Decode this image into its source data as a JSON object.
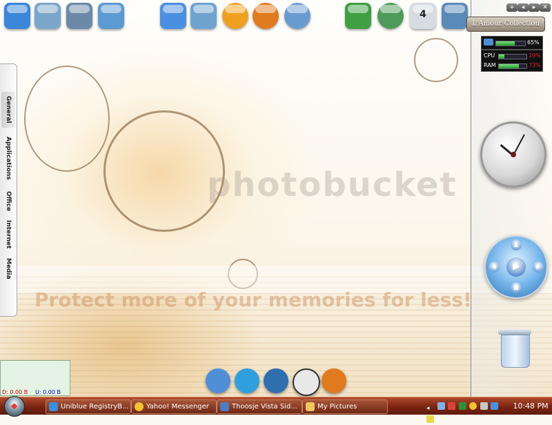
{
  "desktop": {
    "watermark_brand": "photobucket",
    "watermark_line": "Protect more of your memories for less!"
  },
  "top_icons": [
    {
      "name": "my-computer-icon",
      "color": "#3a86d8"
    },
    {
      "name": "documents-icon",
      "color": "#7aa7c9"
    },
    {
      "name": "media-icon",
      "color": "#6c8aa8"
    },
    {
      "name": "network-icon",
      "color": "#5c9ad2"
    },
    {
      "name": "explorer-icon",
      "color": "#4a8fe0"
    },
    {
      "name": "transfer-icon",
      "color": "#6fa3cf"
    },
    {
      "name": "messenger-icon",
      "color": "#f0a020"
    },
    {
      "name": "firefox-icon",
      "color": "#e07a1e"
    },
    {
      "name": "search-icon",
      "color": "#6a9bd0"
    },
    {
      "name": "gecko-icon",
      "color": "#3ea043"
    },
    {
      "name": "settings-icon",
      "color": "#4e9a5a"
    },
    {
      "name": "calendar-icon",
      "color": "#d7dbe2"
    },
    {
      "name": "ship-icon",
      "color": "#5a8ab8"
    }
  ],
  "calendar_day": "4",
  "sidetabs": [
    {
      "label": "General",
      "active": true
    },
    {
      "label": "Applications",
      "active": false
    },
    {
      "label": "Office",
      "active": false
    },
    {
      "label": "Internet",
      "active": false
    },
    {
      "label": "Media",
      "active": false
    }
  ],
  "sidebar": {
    "controls": [
      "+",
      "◂",
      "▸",
      "✕"
    ],
    "title": "L'Amour Collection",
    "battery_value": "65%",
    "battery_percent": 65,
    "cpu_label": "CPU",
    "cpu_value": "19%",
    "cpu_percent": 19,
    "ram_label": "RAM",
    "ram_value": "73%",
    "ram_percent": 73
  },
  "netmon": {
    "down": "D: 0.00 B",
    "up": "U: 0.00 B"
  },
  "dock_icons": [
    {
      "name": "dock-app-icon",
      "color": "#4f8fd6"
    },
    {
      "name": "dock-messenger-icon",
      "color": "#2f9fe0"
    },
    {
      "name": "dock-windows-icon",
      "color": "#2f6fb0"
    },
    {
      "name": "dock-clock-icon",
      "color": "#e8e8e8"
    },
    {
      "name": "dock-firefox-icon",
      "color": "#e07a1e"
    }
  ],
  "taskbar": {
    "tasks": [
      {
        "label": "Uniblue RegistryB...",
        "color": "#3b8de0"
      },
      {
        "label": "Yahoo! Messenger",
        "color": "#f4c22b"
      },
      {
        "label": "Thoosje Vista Sid...",
        "color": "#4a7fc4"
      },
      {
        "label": "My Pictures",
        "color": "#f1c75a"
      }
    ],
    "clock": "10:48 PM"
  }
}
